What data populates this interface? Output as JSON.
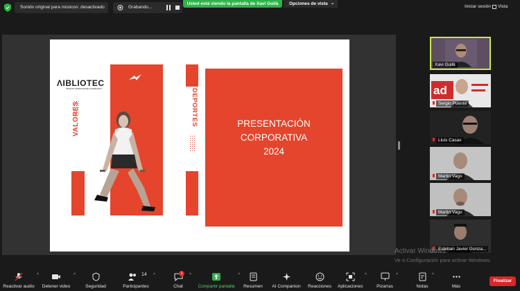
{
  "topbar": {
    "audio_pill": "Sonido original para músicos: desactivado",
    "recording_label": "Grabando...",
    "viewing_banner": "Usted está viendo la pantalla de Xavi Guilà",
    "view_options": "Opciones de vista",
    "sign_in": "Iniciar sesión",
    "view": "Vista"
  },
  "slide": {
    "logo": "ΛIBLIOTEC",
    "logo_sub": "SPORTS WORKHOUSE COMMUNITY",
    "valores": "VALORES",
    "deportes": "DEPORTES",
    "title_lines": [
      "PRESENTACIÓN",
      "CORPORATIVA",
      "2024"
    ],
    "accent_color": "#e4452c"
  },
  "participants": [
    {
      "name": "Xavi Guilà",
      "active": true
    },
    {
      "name": "Sergio Puente",
      "active": false
    },
    {
      "name": "Lluis Casas",
      "active": false
    },
    {
      "name": "Martin Vago",
      "active": false
    },
    {
      "name": "Martin Vago",
      "active": false
    },
    {
      "name": "Esteban Javier Gonza...",
      "active": false
    }
  ],
  "watermark": {
    "line1": "Activar Windows",
    "line2": "Ve a Configuración para activar Windows."
  },
  "toolbar": {
    "audio": "Reactivar audio",
    "video": "Detener video",
    "security": "Seguridad",
    "participants": "Participantes",
    "participants_count": "14",
    "chat": "Chat",
    "chat_badge": "1",
    "share": "Compartir pantalla",
    "summary": "Resumen",
    "ai": "AI Companion",
    "reactions": "Reacciones",
    "apps": "Aplicaciones",
    "whiteboards": "Pizarras",
    "notes": "Notas",
    "more": "Más",
    "end": "Finalizar"
  }
}
